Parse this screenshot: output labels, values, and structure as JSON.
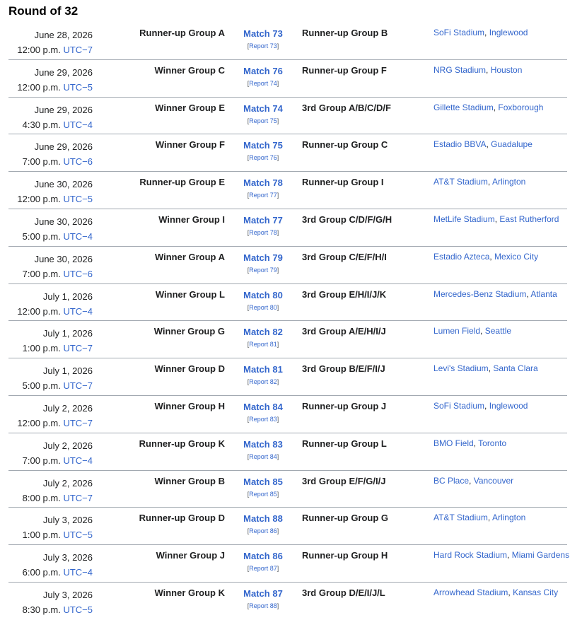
{
  "heading": "Round of 32",
  "matches": [
    {
      "date": "June 28, 2026",
      "time": "12:00 p.m.",
      "tz": "UTC−7",
      "home": "Runner-up Group A",
      "match": "Match 73",
      "report": "Report 73",
      "away": "Runner-up Group B",
      "stadium": "SoFi Stadium",
      "city": "Inglewood"
    },
    {
      "date": "June 29, 2026",
      "time": "12:00 p.m.",
      "tz": "UTC−5",
      "home": "Winner Group C",
      "match": "Match 76",
      "report": "Report 74",
      "away": "Runner-up Group F",
      "stadium": "NRG Stadium",
      "city": "Houston"
    },
    {
      "date": "June 29, 2026",
      "time": "4:30 p.m.",
      "tz": "UTC−4",
      "home": "Winner Group E",
      "match": "Match 74",
      "report": "Report 75",
      "away": "3rd Group A/B/C/D/F",
      "stadium": "Gillette Stadium",
      "city": "Foxborough"
    },
    {
      "date": "June 29, 2026",
      "time": "7:00 p.m.",
      "tz": "UTC−6",
      "home": "Winner Group F",
      "match": "Match 75",
      "report": "Report 76",
      "away": "Runner-up Group C",
      "stadium": "Estadio BBVA",
      "city": "Guadalupe"
    },
    {
      "date": "June 30, 2026",
      "time": "12:00 p.m.",
      "tz": "UTC−5",
      "home": "Runner-up Group E",
      "match": "Match 78",
      "report": "Report 77",
      "away": "Runner-up Group I",
      "stadium": "AT&T Stadium",
      "city": "Arlington"
    },
    {
      "date": "June 30, 2026",
      "time": "5:00 p.m.",
      "tz": "UTC−4",
      "home": "Winner Group I",
      "match": "Match 77",
      "report": "Report 78",
      "away": "3rd Group C/D/F/G/H",
      "stadium": "MetLife Stadium",
      "city": "East Rutherford"
    },
    {
      "date": "June 30, 2026",
      "time": "7:00 p.m.",
      "tz": "UTC−6",
      "home": "Winner Group A",
      "match": "Match 79",
      "report": "Report 79",
      "away": "3rd Group C/E/F/H/I",
      "stadium": "Estadio Azteca",
      "city": "Mexico City"
    },
    {
      "date": "July 1, 2026",
      "time": "12:00 p.m.",
      "tz": "UTC−4",
      "home": "Winner Group L",
      "match": "Match 80",
      "report": "Report 80",
      "away": "3rd Group E/H/I/J/K",
      "stadium": "Mercedes-Benz Stadium",
      "city": "Atlanta"
    },
    {
      "date": "July 1, 2026",
      "time": "1:00 p.m.",
      "tz": "UTC−7",
      "home": "Winner Group G",
      "match": "Match 82",
      "report": "Report 81",
      "away": "3rd Group A/E/H/I/J",
      "stadium": "Lumen Field",
      "city": "Seattle"
    },
    {
      "date": "July 1, 2026",
      "time": "5:00 p.m.",
      "tz": "UTC−7",
      "home": "Winner Group D",
      "match": "Match 81",
      "report": "Report 82",
      "away": "3rd Group B/E/F/I/J",
      "stadium": "Levi's Stadium",
      "city": "Santa Clara"
    },
    {
      "date": "July 2, 2026",
      "time": "12:00 p.m.",
      "tz": "UTC−7",
      "home": "Winner Group H",
      "match": "Match 84",
      "report": "Report 83",
      "away": "Runner-up Group J",
      "stadium": "SoFi Stadium",
      "city": "Inglewood"
    },
    {
      "date": "July 2, 2026",
      "time": "7:00 p.m.",
      "tz": "UTC−4",
      "home": "Runner-up Group K",
      "match": "Match 83",
      "report": "Report 84",
      "away": "Runner-up Group L",
      "stadium": "BMO Field",
      "city": "Toronto"
    },
    {
      "date": "July 2, 2026",
      "time": "8:00 p.m.",
      "tz": "UTC−7",
      "home": "Winner Group B",
      "match": "Match 85",
      "report": "Report 85",
      "away": "3rd Group E/F/G/I/J",
      "stadium": "BC Place",
      "city": "Vancouver"
    },
    {
      "date": "July 3, 2026",
      "time": "1:00 p.m.",
      "tz": "UTC−5",
      "home": "Runner-up Group D",
      "match": "Match 88",
      "report": "Report 86",
      "away": "Runner-up Group G",
      "stadium": "AT&T Stadium",
      "city": "Arlington"
    },
    {
      "date": "July 3, 2026",
      "time": "6:00 p.m.",
      "tz": "UTC−4",
      "home": "Winner Group J",
      "match": "Match 86",
      "report": "Report 87",
      "away": "Runner-up Group H",
      "stadium": "Hard Rock Stadium",
      "city": "Miami Gardens"
    },
    {
      "date": "July 3, 2026",
      "time": "8:30 p.m.",
      "tz": "UTC−5",
      "home": "Winner Group K",
      "match": "Match 87",
      "report": "Report 88",
      "away": "3rd Group D/E/I/J/L",
      "stadium": "Arrowhead Stadium",
      "city": "Kansas City"
    }
  ]
}
